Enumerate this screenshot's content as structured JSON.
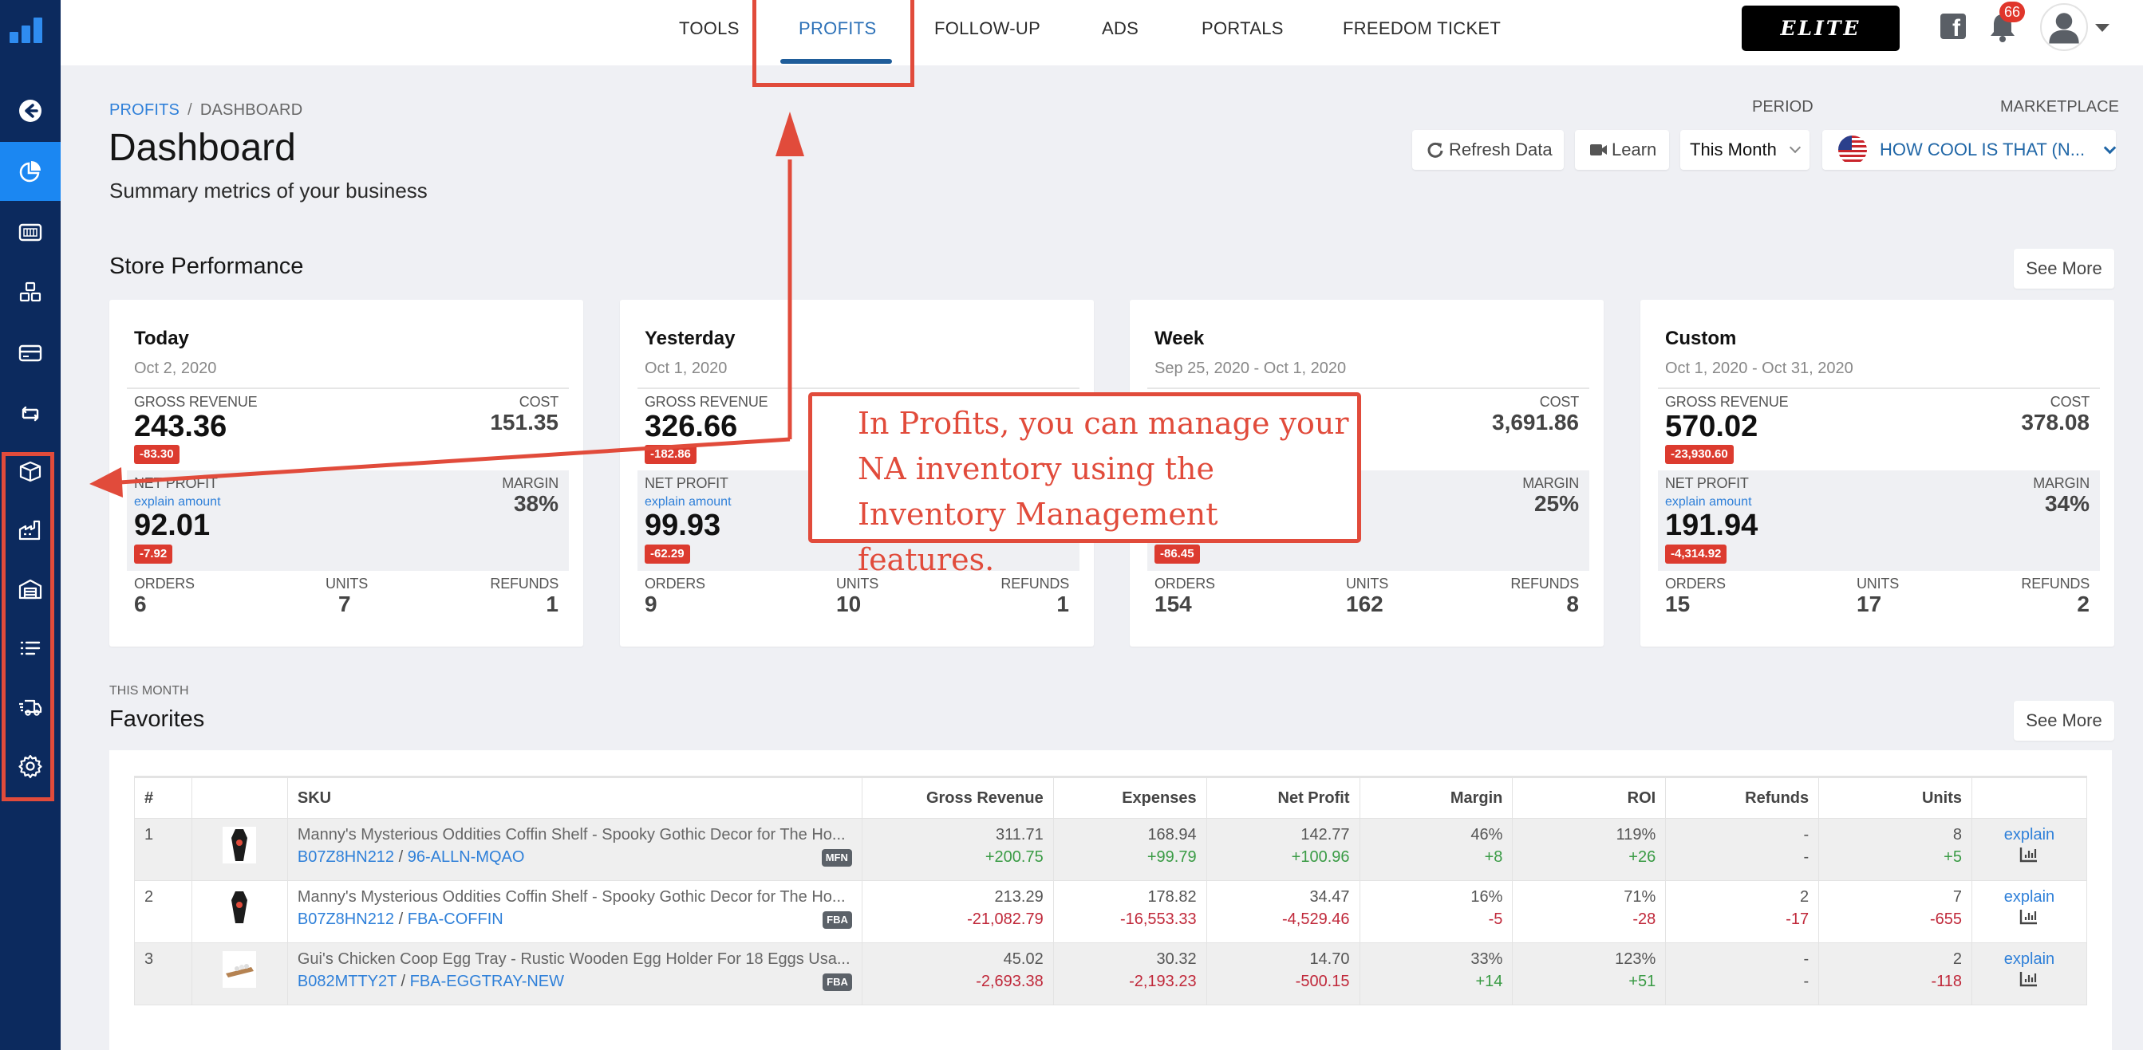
{
  "sidebar": {
    "items": [
      {
        "name": "back",
        "icon": "arrow-left-circle-icon"
      },
      {
        "name": "dashboard",
        "icon": "pie-chart-icon",
        "active": true
      },
      {
        "name": "calendar",
        "icon": "calendar-grid-icon"
      },
      {
        "name": "products",
        "icon": "boxes-icon"
      },
      {
        "name": "billing",
        "icon": "credit-card-icon"
      },
      {
        "name": "transfers",
        "icon": "swap-arrows-icon"
      },
      {
        "name": "inventory",
        "icon": "box-icon"
      },
      {
        "name": "suppliers",
        "icon": "factory-icon"
      },
      {
        "name": "warehouse",
        "icon": "warehouse-icon"
      },
      {
        "name": "lists",
        "icon": "list-icon"
      },
      {
        "name": "shipments",
        "icon": "truck-icon"
      },
      {
        "name": "settings",
        "icon": "gear-icon"
      }
    ]
  },
  "topnav": {
    "tabs": [
      {
        "label": "TOOLS"
      },
      {
        "label": "PROFITS",
        "active": true
      },
      {
        "label": "FOLLOW-UP"
      },
      {
        "label": "ADS"
      },
      {
        "label": "PORTALS"
      },
      {
        "label": "FREEDOM TICKET"
      }
    ],
    "elite_label": "ELITE",
    "notifications_count": "66"
  },
  "header": {
    "breadcrumb": {
      "parent": "PROFITS",
      "separator": "/",
      "current": "DASHBOARD"
    },
    "title": "Dashboard",
    "subtitle": "Summary metrics of your business",
    "period_label": "PERIOD",
    "marketplace_label": "MARKETPLACE",
    "refresh_label": "Refresh Data",
    "learn_label": "Learn",
    "period_value": "This Month",
    "marketplace_value": "HOW COOL IS THAT (N..."
  },
  "store_performance": {
    "title": "Store Performance",
    "see_more": "See More",
    "labels": {
      "gross_revenue": "GROSS REVENUE",
      "cost": "COST",
      "net_profit": "NET PROFIT",
      "margin": "MARGIN",
      "explain": "explain amount",
      "orders": "ORDERS",
      "units": "UNITS",
      "refunds": "REFUNDS"
    },
    "cards": [
      {
        "title": "Today",
        "date": "Oct 2, 2020",
        "gross_revenue": "243.36",
        "gross_delta": "-83.30",
        "cost": "151.35",
        "net_profit": "92.01",
        "net_delta": "-7.92",
        "margin": "38%",
        "orders": "6",
        "units": "7",
        "refunds": "1"
      },
      {
        "title": "Yesterday",
        "date": "Oct 1, 2020",
        "gross_revenue": "326.66",
        "gross_delta": "-182.86",
        "cost": "",
        "net_profit": "99.93",
        "net_delta": "-62.29",
        "margin": "",
        "orders": "9",
        "units": "10",
        "refunds": "1"
      },
      {
        "title": "Week",
        "date": "Sep 25, 2020 - Oct 1, 2020",
        "gross_revenue": "",
        "gross_delta": "",
        "cost": "3,691.86",
        "net_profit": "",
        "net_delta": "-86.45",
        "margin": "25%",
        "orders": "154",
        "units": "162",
        "refunds": "8"
      },
      {
        "title": "Custom",
        "date": "Oct 1, 2020 - Oct 31, 2020",
        "gross_revenue": "570.02",
        "gross_delta": "-23,930.60",
        "cost": "378.08",
        "net_profit": "191.94",
        "net_delta": "-4,314.92",
        "margin": "34%",
        "orders": "15",
        "units": "17",
        "refunds": "2"
      }
    ]
  },
  "favorites": {
    "eyebrow": "THIS MONTH",
    "title": "Favorites",
    "see_more": "See More",
    "columns": [
      "#",
      "",
      "SKU",
      "Gross Revenue",
      "Expenses",
      "Net Profit",
      "Margin",
      "ROI",
      "Refunds",
      "Units",
      ""
    ],
    "rows": [
      {
        "index": "1",
        "thumb": "coffin-shelf",
        "title": "Manny's Mysterious Oddities Coffin Shelf - Spooky Gothic Decor for The Ho...",
        "asin": "B07Z8HN212",
        "sku": "96-ALLN-MQAO",
        "channel": "MFN",
        "gross": "311.71",
        "gross_d": "+200.75",
        "exp": "168.94",
        "exp_d": "+99.79",
        "net": "142.77",
        "net_d": "+100.96",
        "margin": "46%",
        "margin_d": "+8",
        "roi": "119%",
        "roi_d": "+26",
        "refunds": "-",
        "refunds_d": "-",
        "units": "8",
        "units_d": "+5",
        "explain": "explain"
      },
      {
        "index": "2",
        "thumb": "coffin-shelf",
        "title": "Manny's Mysterious Oddities Coffin Shelf - Spooky Gothic Decor for The Ho...",
        "asin": "B07Z8HN212",
        "sku": "FBA-COFFIN",
        "channel": "FBA",
        "gross": "213.29",
        "gross_d": "-21,082.79",
        "exp": "178.82",
        "exp_d": "-16,553.33",
        "net": "34.47",
        "net_d": "-4,529.46",
        "margin": "16%",
        "margin_d": "-5",
        "roi": "71%",
        "roi_d": "-28",
        "refunds": "2",
        "refunds_d": "-17",
        "units": "7",
        "units_d": "-655",
        "explain": "explain"
      },
      {
        "index": "3",
        "thumb": "egg-tray",
        "title": "Gui's Chicken Coop Egg Tray - Rustic Wooden Egg Holder For 18 Eggs Usa...",
        "asin": "B082MTTY2T",
        "sku": "FBA-EGGTRAY-NEW",
        "channel": "FBA",
        "gross": "45.02",
        "gross_d": "-2,693.38",
        "exp": "30.32",
        "exp_d": "-2,193.23",
        "net": "14.70",
        "net_d": "-500.15",
        "margin": "33%",
        "margin_d": "+14",
        "roi": "123%",
        "roi_d": "+51",
        "refunds": "-",
        "refunds_d": "-",
        "units": "2",
        "units_d": "-118",
        "explain": "explain"
      }
    ]
  },
  "annotation": {
    "text": "In Profits, you can manage your NA inventory using the Inventory Management features.",
    "color": "#e14b3b"
  },
  "colors": {
    "sidebar_bg": "#0c2a5e",
    "sidebar_active": "#1b87f2",
    "accent_blue": "#2f80d9",
    "negative_badge": "#dc3b2f",
    "positive_text": "#3a9b45",
    "negative_text": "#c0283a"
  }
}
